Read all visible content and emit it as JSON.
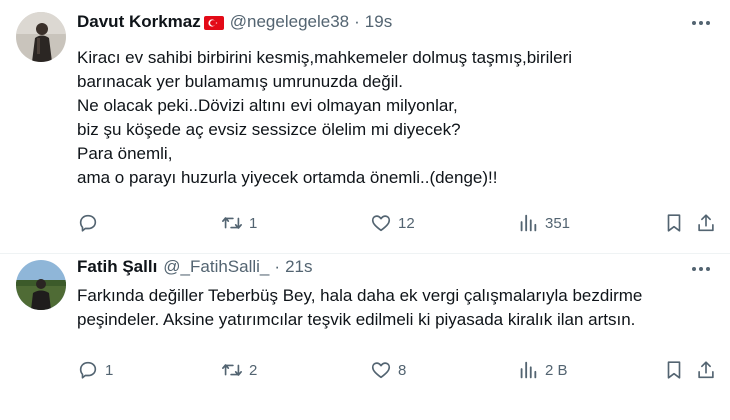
{
  "tweets": [
    {
      "name": "Davut Korkmaz",
      "handle": "@negelegele38",
      "time": "19s",
      "has_flag": true,
      "lines": [
        "Kiracı ev sahibi birbirini kesmiş,mahkemeler dolmuş taşmış,birileri",
        "barınacak yer bulamamış umrunuzda değil.",
        "Ne olacak peki..Dövizi altını evi olmayan milyonlar,",
        "biz şu köşede aç evsiz sessizce ölelim mi diyecek?",
        "Para önemli,",
        "ama o parayı huzurla yiyecek ortamda önemli..(denge)!!"
      ],
      "replies": "",
      "retweets": "1",
      "likes": "12",
      "views": "351"
    },
    {
      "name": "Fatih Şallı",
      "handle": "@_FatihSalli_",
      "time": "21s",
      "has_flag": false,
      "lines": [
        "Farkında değiller Teberbüş Bey, hala daha ek vergi çalışmalarıyla bezdirme",
        "peşindeler. Aksine yatırımcılar teşvik edilmeli ki piyasada kiralık ilan artsın."
      ],
      "replies": "1",
      "retweets": "2",
      "likes": "8",
      "views": "2 B"
    }
  ],
  "icons": [
    "reply-icon",
    "retweet-icon",
    "like-icon",
    "views-icon",
    "bookmark-icon",
    "share-icon",
    "more-icon"
  ],
  "colors": {
    "text": "#0f1419",
    "muted": "#536471",
    "divider": "#eff3f4",
    "flag_red": "#e30a17"
  }
}
